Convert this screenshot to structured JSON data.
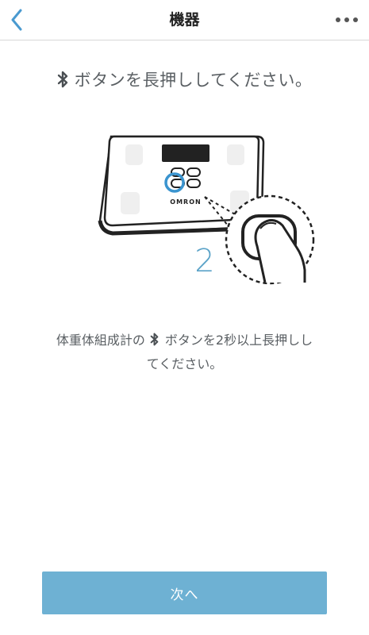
{
  "header": {
    "title": "機器",
    "back_icon": "chevron-left-icon",
    "more_icon": "more-horizontal-icon"
  },
  "instruction": {
    "text": "ボタンを長押ししてください。",
    "icon": "bluetooth-icon"
  },
  "illustration": {
    "brand": "OMRON",
    "step_number": "2"
  },
  "description": {
    "part1": "体重体組成計の",
    "part2": "ボタンを2秒以上長押しし",
    "part3": "てください。",
    "icon": "bluetooth-icon"
  },
  "next_button": {
    "label": "次へ"
  },
  "colors": {
    "accent": "#4a9ad0",
    "button": "#6eb1d3",
    "step_number": "#5ba3c8"
  }
}
